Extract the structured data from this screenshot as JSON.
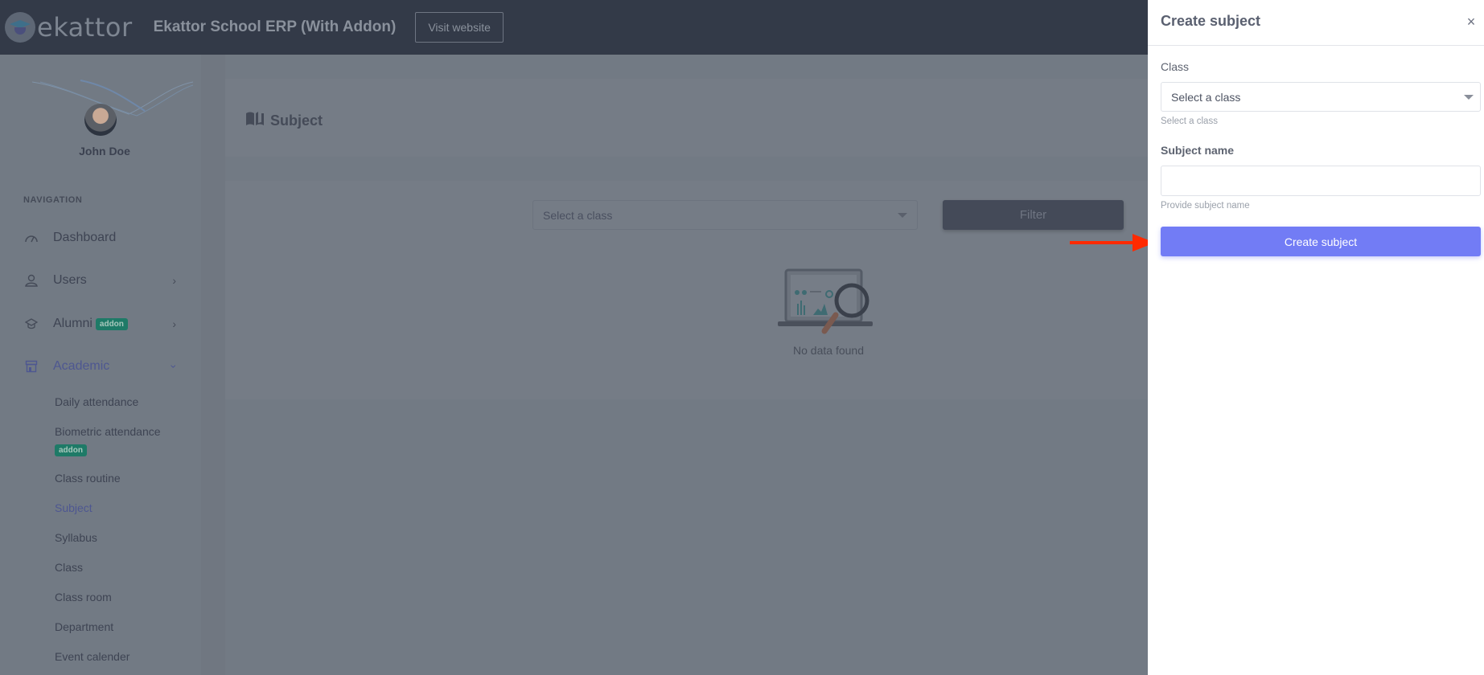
{
  "header": {
    "logo_text": "ekattor",
    "app_title": "Ekattor School ERP (With Addon)",
    "visit_website_label": "Visit website"
  },
  "sidebar": {
    "profile_name": "John Doe",
    "nav_heading": "NAVIGATION",
    "items": [
      {
        "label": "Dashboard",
        "icon": "dashboard-gauge-icon"
      },
      {
        "label": "Users",
        "icon": "user-icon"
      },
      {
        "label": "Alumni",
        "icon": "graduation-cap-icon",
        "badge": "addon"
      },
      {
        "label": "Academic",
        "icon": "building-icon",
        "active": true
      }
    ],
    "academic_subitems": [
      {
        "label": "Daily attendance"
      },
      {
        "label": "Biometric attendance",
        "badge": "addon"
      },
      {
        "label": "Class routine"
      },
      {
        "label": "Subject",
        "active": true
      },
      {
        "label": "Syllabus"
      },
      {
        "label": "Class"
      },
      {
        "label": "Class room"
      },
      {
        "label": "Department"
      },
      {
        "label": "Event calender"
      }
    ]
  },
  "main": {
    "page_title": "Subject",
    "class_select_value": "Select a class",
    "filter_label": "Filter",
    "empty_text": "No data found"
  },
  "panel": {
    "title": "Create subject",
    "close_icon": "×",
    "class_label": "Class",
    "class_select_value": "Select a class",
    "class_help": "Select a class",
    "subject_name_label": "Subject name",
    "subject_name_value": "",
    "subject_name_help": "Provide subject name",
    "submit_label": "Create subject"
  },
  "colors": {
    "primary": "#727cf5",
    "addon_badge": "#1e7a67",
    "annotation_arrow": "#ff2a00",
    "topbar": "#333a48"
  }
}
